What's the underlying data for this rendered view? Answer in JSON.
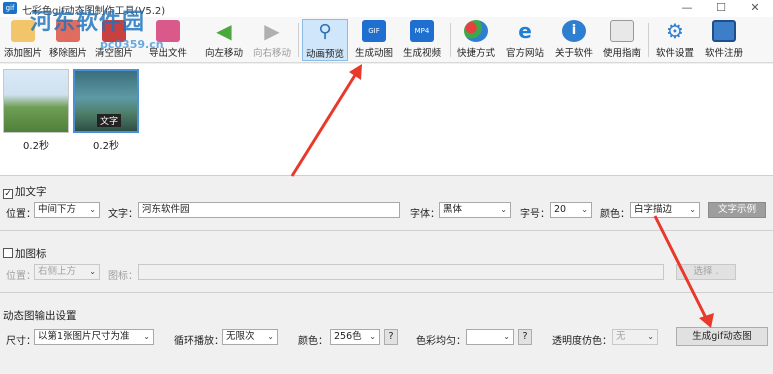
{
  "window": {
    "title": "七彩色gif动态图制作工具(V5.2)",
    "controls": [
      "—",
      "☐",
      "✕"
    ]
  },
  "watermark": {
    "main": "河东软件园",
    "sub": "pc0359.cn"
  },
  "toolbar": {
    "items": [
      {
        "label": "添加图片",
        "icon": "add-image-icon"
      },
      {
        "label": "移除图片",
        "icon": "remove-image-icon"
      },
      {
        "label": "清空图片",
        "icon": "clear-images-icon"
      },
      {
        "label": "导出文件",
        "icon": "export-file-icon"
      },
      {
        "label": "向左移动",
        "icon": "arrow-left-icon"
      },
      {
        "label": "向右移动",
        "icon": "arrow-right-icon"
      },
      {
        "label": "动画预览",
        "icon": "preview-icon"
      },
      {
        "label": "生成动图",
        "icon": "gif-icon",
        "badge": "GIF"
      },
      {
        "label": "生成视频",
        "icon": "mp4-icon",
        "badge": "MP4"
      },
      {
        "label": "快捷方式",
        "icon": "shortcut-icon"
      },
      {
        "label": "官方网站",
        "icon": "ie-icon"
      },
      {
        "label": "关于软件",
        "icon": "info-icon"
      },
      {
        "label": "使用指南",
        "icon": "guide-icon"
      },
      {
        "label": "软件设置",
        "icon": "gear-icon"
      },
      {
        "label": "软件注册",
        "icon": "register-icon"
      }
    ]
  },
  "thumbnails": [
    {
      "caption": "0.2秒",
      "badge": ""
    },
    {
      "caption": "0.2秒",
      "badge": "文字"
    }
  ],
  "add_text": {
    "checkbox_label": "加文字",
    "checked": true,
    "position_label": "位置：",
    "position_value": "中间下方",
    "text_label": "文字：",
    "text_value": "河东软件园",
    "font_label": "字体：",
    "font_value": "黑体",
    "size_label": "字号：",
    "size_value": "20",
    "color_label": "颜色：",
    "color_value": "白字描边",
    "sample_button": "文字示例"
  },
  "add_icon": {
    "checkbox_label": "加图标",
    "checked": false,
    "position_label": "位置：",
    "position_value": "右侧上方",
    "icon_label": "图标：",
    "icon_value": "",
    "browse_button": "选择 ."
  },
  "output": {
    "section_label": "动态图输出设置",
    "size_label": "尺寸：",
    "size_value": "以第1张图片尺寸为准",
    "loop_label": "循环播放：",
    "loop_value": "无限次",
    "colors_label": "颜色：",
    "colors_value": "256色",
    "colors_help": "?",
    "dither_label": "色彩均匀：",
    "dither_value": "",
    "dither_help": "?",
    "transparent_label": "透明度仿色：",
    "transparent_value": "无",
    "generate_button": "生成gif动态图"
  },
  "colors": {
    "accent": "#4b8fd6",
    "annotation_arrow": "#e8392b",
    "toolbar_active": "#cfe6fb"
  }
}
